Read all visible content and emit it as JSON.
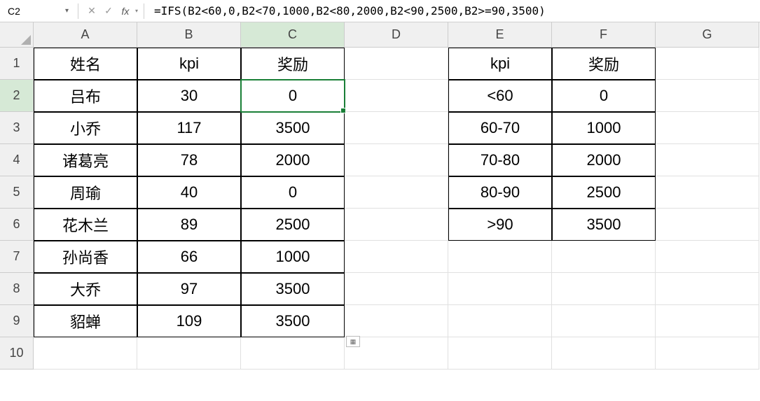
{
  "formula_bar": {
    "cell_ref": "C2",
    "fx_label": "fx",
    "formula": "=IFS(B2<60,0,B2<70,1000,B2<80,2000,B2<90,2500,B2>=90,3500)"
  },
  "columns": [
    "A",
    "B",
    "C",
    "D",
    "E",
    "F",
    "G"
  ],
  "row_count": 10,
  "selected_cell": "C2",
  "main": {
    "headers": [
      "姓名",
      "kpi",
      "奖励"
    ],
    "rows": [
      [
        "吕布",
        "30",
        "0"
      ],
      [
        "小乔",
        "117",
        "3500"
      ],
      [
        "诸葛亮",
        "78",
        "2000"
      ],
      [
        "周瑜",
        "40",
        "0"
      ],
      [
        "花木兰",
        "89",
        "2500"
      ],
      [
        "孙尚香",
        "66",
        "1000"
      ],
      [
        "大乔",
        "97",
        "3500"
      ],
      [
        "貂蝉",
        "109",
        "3500"
      ]
    ]
  },
  "lookup": {
    "headers": [
      "kpi",
      "奖励"
    ],
    "rows": [
      [
        "<60",
        "0"
      ],
      [
        "60-70",
        "1000"
      ],
      [
        "70-80",
        "2000"
      ],
      [
        "80-90",
        "2500"
      ],
      [
        ">90",
        "3500"
      ]
    ]
  }
}
